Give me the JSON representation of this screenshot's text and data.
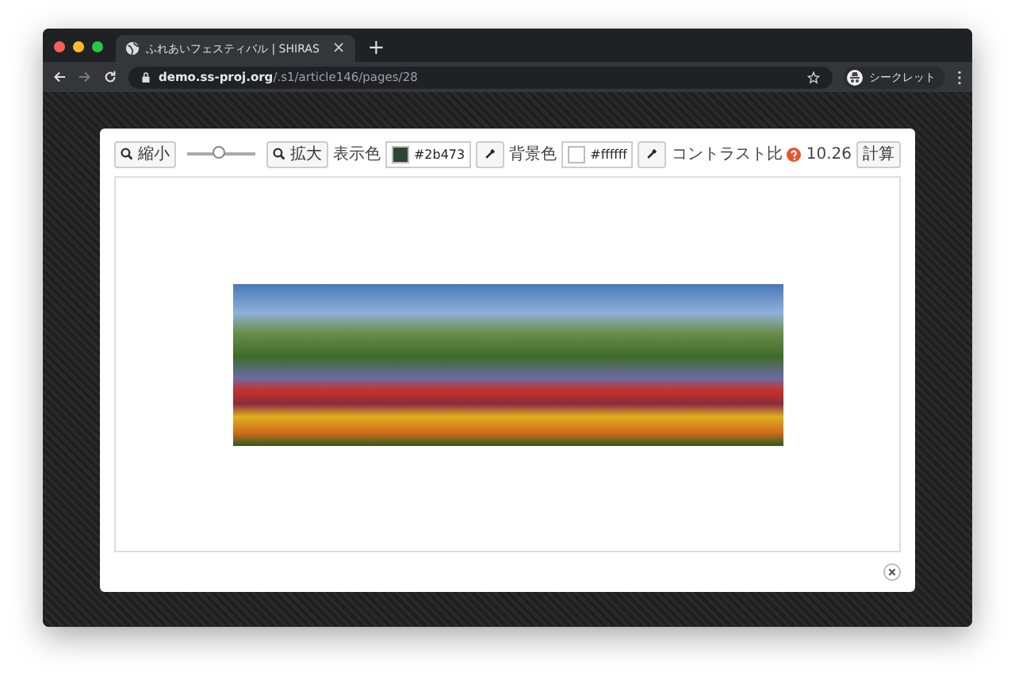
{
  "browser": {
    "tab": {
      "title": "ふれあいフェスティバル | SHIRAS",
      "selected": true
    },
    "close_tab": "×",
    "new_tab": "+",
    "url_host": "demo.ss-proj.org",
    "url_path": "/.s1/article146/pages/28",
    "profile": "シークレット"
  },
  "toolbar": {
    "zoom_out": "縮小",
    "zoom_slider": {
      "level": 0.47
    },
    "zoom_in": "拡大",
    "colors": [
      {
        "label": "表示色",
        "value": "#2b473",
        "color": "#2b4730"
      },
      {
        "label": "背景色",
        "value": "#ffffff",
        "color": "#ffffff"
      }
    ],
    "contrast_label": "コントラスト比",
    "contrast_value": "10.26",
    "calc": "計算"
  }
}
